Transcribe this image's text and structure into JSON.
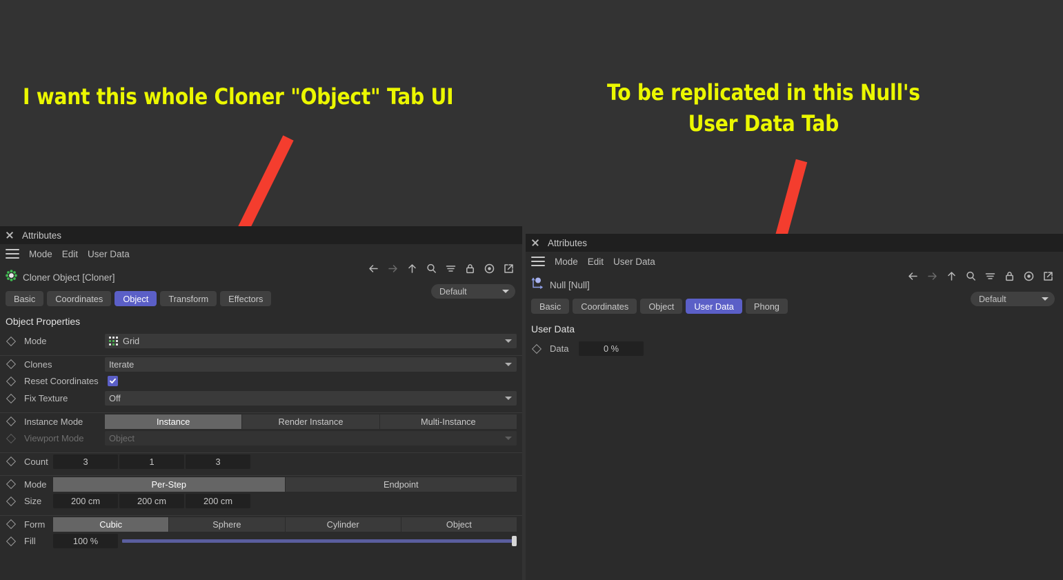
{
  "annotations": [
    {
      "id": "left-note",
      "text": "I want this whole Cloner \"Object\" Tab UI",
      "color": "#ebf700"
    },
    {
      "id": "right-note",
      "text": "To be replicated in this Null's\nUser Data Tab",
      "color": "#ebf700"
    }
  ],
  "arrow_color": "#f43d2e",
  "accent_color": "#5b5fc7",
  "slider_color": "#5a5e9e",
  "left_panel": {
    "titlebar": {
      "title": "Attributes",
      "close_label": "x"
    },
    "menu": [
      "Mode",
      "Edit",
      "User Data"
    ],
    "toolbar_icons": [
      "back-arrow-icon",
      "forward-arrow-icon",
      "up-arrow-icon",
      "search-icon",
      "filter-icon",
      "lock-icon",
      "record-icon",
      "popout-icon"
    ],
    "preset": {
      "value": "Default"
    },
    "object": {
      "icon": "cloner-gear-icon",
      "label": "Cloner Object [Cloner]"
    },
    "tabs": [
      {
        "label": "Basic",
        "active": false
      },
      {
        "label": "Coordinates",
        "active": false
      },
      {
        "label": "Object",
        "active": true
      },
      {
        "label": "Transform",
        "active": false
      },
      {
        "label": "Effectors",
        "active": false
      }
    ],
    "section_title": "Object Properties",
    "rows": [
      {
        "label": "Mode",
        "type": "dropdown-icon",
        "value": "Grid",
        "icon": "grid-icon",
        "separator": false
      },
      {
        "label": "Clones",
        "type": "dropdown",
        "value": "Iterate",
        "separator": true
      },
      {
        "label": "Reset Coordinates",
        "type": "checkbox",
        "checked": true,
        "separator": false
      },
      {
        "label": "Fix Texture",
        "type": "dropdown",
        "value": "Off",
        "separator": false
      },
      {
        "label": "Instance Mode",
        "type": "segments",
        "options": [
          "Instance",
          "Render Instance",
          "Multi-Instance"
        ],
        "selected": 0,
        "separator": true
      },
      {
        "label": "Viewport Mode",
        "type": "dropdown",
        "value": "Object",
        "disabled": true,
        "separator": false
      },
      {
        "label": "Count",
        "type": "numbers",
        "values": [
          "3",
          "1",
          "3"
        ],
        "separator": true
      },
      {
        "label": "Mode",
        "type": "segments",
        "options": [
          "Per-Step",
          "Endpoint"
        ],
        "selected": 0,
        "separator": true
      },
      {
        "label": "Size",
        "type": "numbers",
        "values": [
          "200 cm",
          "200 cm",
          "200 cm"
        ],
        "separator": false
      },
      {
        "label": "Form",
        "type": "segments",
        "options": [
          "Cubic",
          "Sphere",
          "Cylinder",
          "Object"
        ],
        "selected": 0,
        "separator": true
      },
      {
        "label": "Fill",
        "type": "slider",
        "value": "100 %",
        "percent": 100,
        "separator": false
      }
    ]
  },
  "right_panel": {
    "titlebar": {
      "title": "Attributes",
      "close_label": "x"
    },
    "menu": [
      "Mode",
      "Edit",
      "User Data"
    ],
    "toolbar_icons": [
      "back-arrow-icon",
      "forward-arrow-icon",
      "up-arrow-icon",
      "search-icon",
      "filter-icon",
      "lock-icon",
      "record-icon",
      "popout-icon"
    ],
    "preset": {
      "value": "Default"
    },
    "object": {
      "icon": "null-axis-icon",
      "label": "Null [Null]"
    },
    "tabs": [
      {
        "label": "Basic",
        "active": false
      },
      {
        "label": "Coordinates",
        "active": false
      },
      {
        "label": "Object",
        "active": false
      },
      {
        "label": "User Data",
        "active": true
      },
      {
        "label": "Phong",
        "active": false
      }
    ],
    "section_title": "User Data",
    "rows": [
      {
        "label": "Data",
        "type": "numbers",
        "values": [
          "0 %"
        ],
        "separator": false
      }
    ]
  }
}
